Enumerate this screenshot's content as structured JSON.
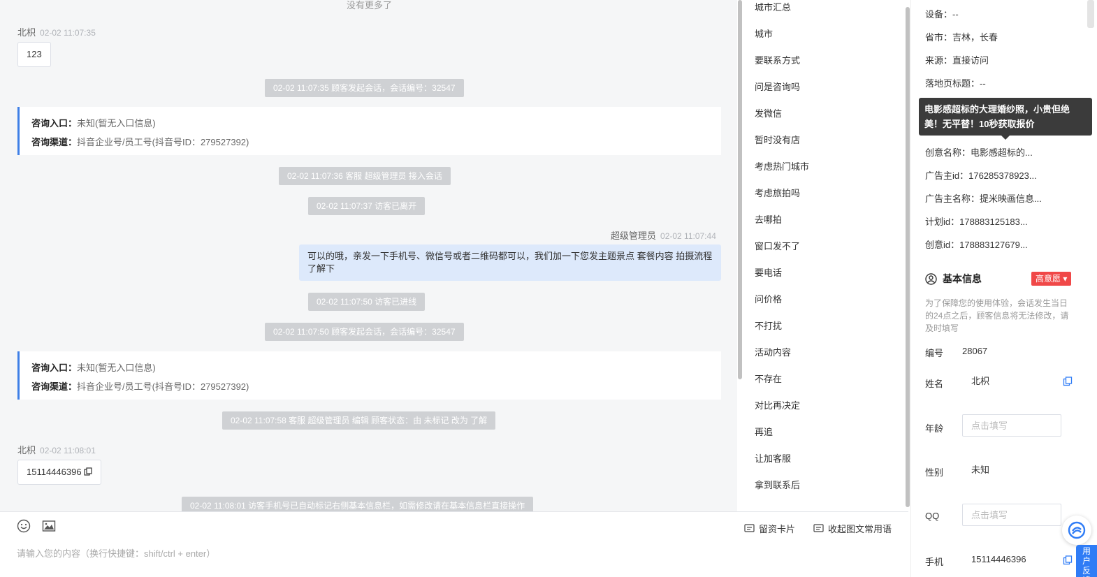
{
  "chat": {
    "no_more": "没有更多了",
    "messages": [
      {
        "name": "北枳",
        "time": "02-02 11:07:35",
        "text": "123"
      },
      {
        "name": "超级管理员",
        "time": "02-02 11:07:44",
        "text": "可以的哦，亲发一下手机号、微信号或者二维码都可以，我们加一下您发主题景点 套餐内容 拍摄流程了解下"
      },
      {
        "name": "北枳",
        "time": "02-02 11:08:01",
        "text": "15114446396"
      }
    ],
    "system": [
      "02-02 11:07:35 顾客发起会话，会话编号：32547",
      "02-02 11:07:36 客服 超级管理员 接入会话",
      "02-02 11:07:37 访客已离开",
      "02-02 11:07:50 访客已进线",
      "02-02 11:07:50 顾客发起会话，会话编号：32547",
      "02-02 11:07:58 客服 超级管理员 编辑 顾客状态：由 未标记 改为 了解",
      "02-02 11:08:01 访客手机号已自动标记右侧基本信息栏，如需修改请在基本信息栏直接操作"
    ],
    "cards": [
      {
        "entry_label": "咨询入口：",
        "entry_value": "未知(暂无入口信息)",
        "channel_label": "咨询渠道：",
        "channel_value": "抖音企业号/员工号(抖音号ID：279527392)"
      },
      {
        "entry_label": "咨询入口：",
        "entry_value": "未知(暂无入口信息)",
        "channel_label": "咨询渠道：",
        "channel_value": "抖音企业号/员工号(抖音号ID：279527392)"
      }
    ]
  },
  "quick_replies": [
    "城市汇总",
    "城市",
    "要联系方式",
    "问是咨询吗",
    "发微信",
    "暂时没有店",
    "考虑热门城市",
    "考虑旅拍吗",
    "去哪拍",
    "窗口发不了",
    "要电话",
    "问价格",
    "不打扰",
    "活动内容",
    "不存在",
    "对比再决定",
    "再追",
    "让加客服",
    "拿到联系后"
  ],
  "composer": {
    "placeholder": "请输入您的内容（换行快捷键：shift/ctrl + enter）",
    "card_label": "留资卡片",
    "collapse_label": "收起图文常用语"
  },
  "panel": {
    "info": [
      "设备：--",
      "省市：吉林，长春",
      "来源：直接访问",
      "落地页标题：--",
      "创意名称：电影感超标的...",
      "广告主id：176285378923...",
      "广告主名称：提米映画信息...",
      "计划id：178883125183...",
      "创意id：178883127679..."
    ],
    "tooltip": "电影感超标的大理婚纱照，小贵但绝美！无平替！10秒获取报价",
    "basic_title": "基本信息",
    "intent_badge": "高意愿",
    "notice": "为了保障您的使用体验，会话发生当日的24点之后，顾客信息将无法修改，请及时填写",
    "fields": {
      "id_label": "编号",
      "id_value": "28067",
      "name_label": "姓名",
      "name_value": "北枳",
      "age_label": "年龄",
      "age_placeholder": "点击填写",
      "gender_label": "性别",
      "gender_value": "未知",
      "qq_label": "QQ",
      "qq_placeholder": "点击填写",
      "phone_label": "手机",
      "phone_value": "15114446396"
    },
    "feedback": "用户反馈"
  }
}
